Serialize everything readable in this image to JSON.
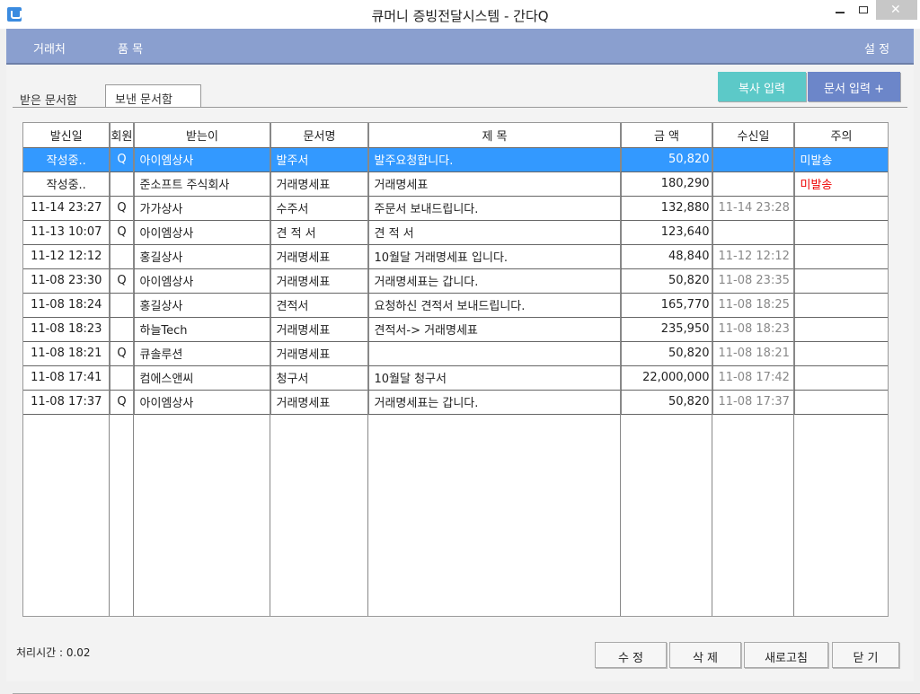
{
  "window": {
    "title": "큐머니 증빙전달시스템 - 간다Q"
  },
  "menubar": {
    "items": [
      "거래처",
      "품 목"
    ],
    "settings": "설 정"
  },
  "tabs": [
    "받은 문서함",
    "보낸 문서함"
  ],
  "toolbar": {
    "copy_input": "복사 입력",
    "doc_input": "문서 입력 +"
  },
  "table": {
    "columns": [
      "발신일",
      "회원",
      "받는이",
      "문서명",
      "제 목",
      "금 액",
      "수신일",
      "주의"
    ],
    "rows": [
      [
        "작성중..",
        "Q",
        "아이엠상사",
        "발주서",
        "발주요청합니다.",
        "50,820",
        "",
        "미발송"
      ],
      [
        "작성중..",
        "",
        "준소프트 주식회사",
        "거래명세표",
        "거래명세표",
        "180,290",
        "",
        "미발송"
      ],
      [
        "11-14 23:27",
        "Q",
        "가가상사",
        "수주서",
        "주문서 보내드립니다.",
        "132,880",
        "11-14 23:28",
        ""
      ],
      [
        "11-13 10:07",
        "Q",
        "아이엠상사",
        "견 적 서",
        "견 적 서",
        "123,640",
        "",
        ""
      ],
      [
        "11-12 12:12",
        "",
        "홍길상사",
        "거래명세표",
        "10월달 거래명세표 입니다.",
        "48,840",
        "11-12 12:12",
        ""
      ],
      [
        "11-08 23:30",
        "Q",
        "아이엠상사",
        "거래명세표",
        "거래명세표는 갑니다.",
        "50,820",
        "11-08 23:35",
        ""
      ],
      [
        "11-08 18:24",
        "",
        "홍길상사",
        "견적서",
        "요청하신 견적서 보내드립니다.",
        "165,770",
        "11-08 18:25",
        ""
      ],
      [
        "11-08 18:23",
        "",
        "하늘Tech",
        "거래명세표",
        "견적서-> 거래명세표",
        "235,950",
        "11-08 18:23",
        ""
      ],
      [
        "11-08 18:21",
        "Q",
        "큐솔루션",
        "거래명세표",
        "",
        "50,820",
        "11-08 18:21",
        ""
      ],
      [
        "11-08 17:41",
        "",
        "컴에스앤씨",
        "청구서",
        "10월달 청구서",
        "22,000,000",
        "11-08 17:42",
        ""
      ],
      [
        "11-08 17:37",
        "Q",
        "아이엠상사",
        "거래명세표",
        "거래명세표는 갑니다.",
        "50,820",
        "11-08 17:37",
        ""
      ]
    ]
  },
  "status": {
    "text": "처리시간 : 0.02"
  },
  "footer": {
    "edit": "수 정",
    "delete": "삭 제",
    "refresh": "새로고침",
    "close": "닫 기"
  }
}
